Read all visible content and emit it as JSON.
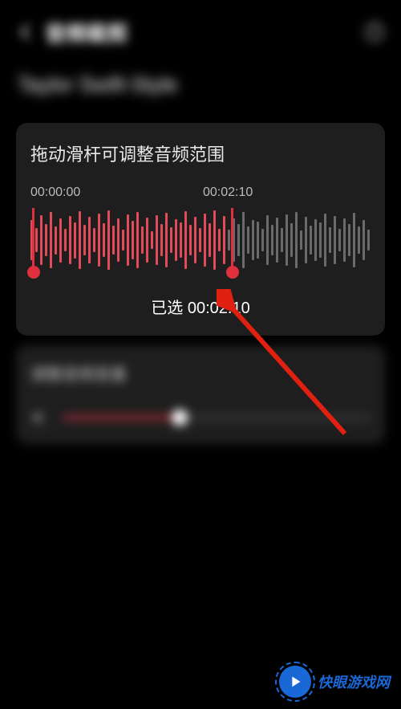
{
  "header": {
    "title": "音频裁剪"
  },
  "subtitle": "Taylor Swift-Style",
  "trim": {
    "title": "拖动滑杆可调整音频范围",
    "start_time": "00:00:00",
    "end_time": "00:02:10",
    "selected_prefix": "已选 ",
    "selected_time": "00:02:10"
  },
  "volume": {
    "title": "调整音频音量"
  },
  "watermark": {
    "text": "快眼游戏网"
  },
  "colors": {
    "accent": "#e03040",
    "brand": "#1a67d6"
  }
}
